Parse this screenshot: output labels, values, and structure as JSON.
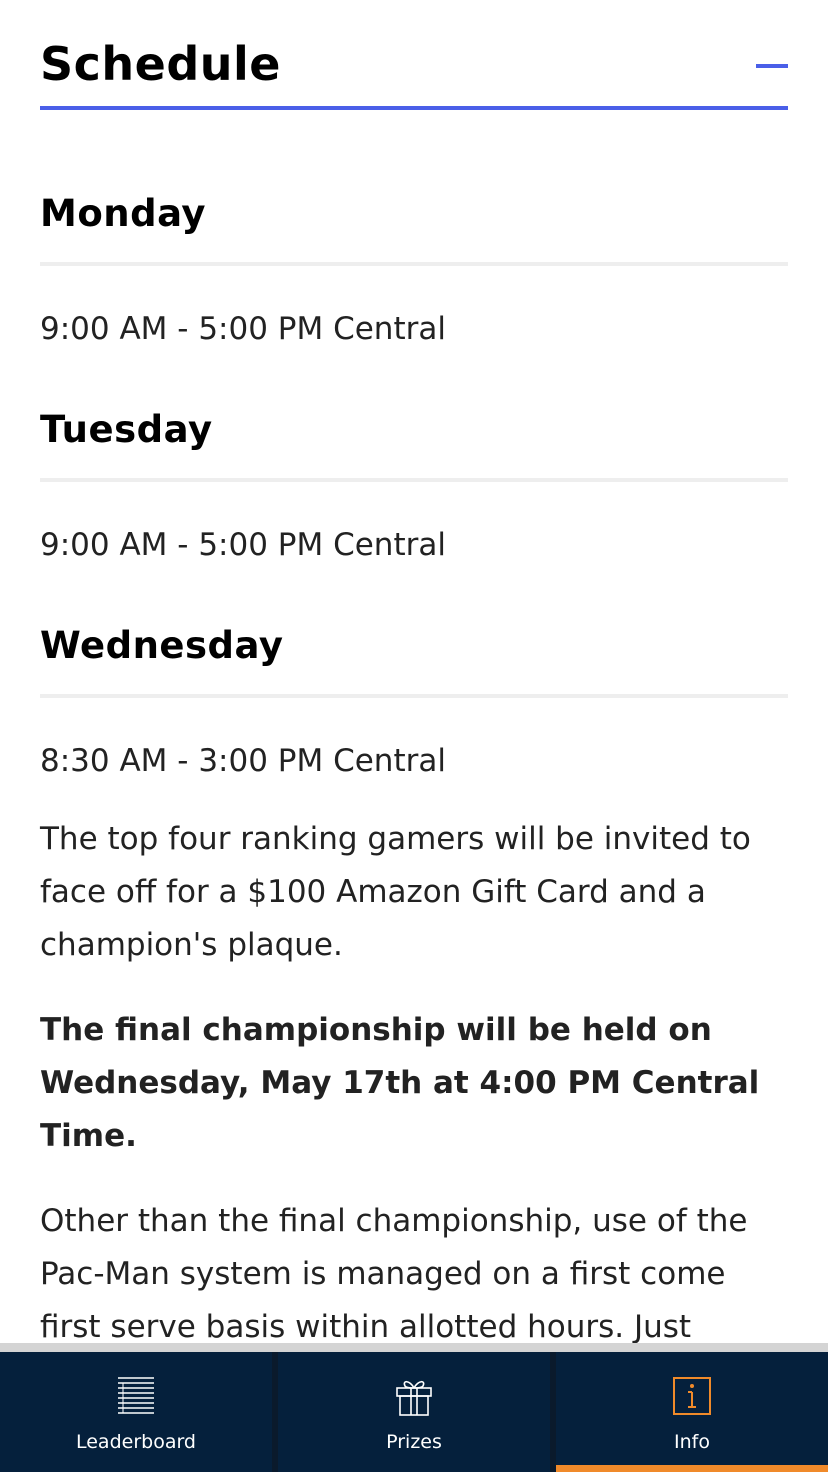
{
  "section": {
    "title": "Schedule"
  },
  "schedule": [
    {
      "day": "Monday",
      "hours": "9:00 AM - 5:00 PM Central"
    },
    {
      "day": "Tuesday",
      "hours": "9:00 AM - 5:00 PM Central"
    },
    {
      "day": "Wednesday",
      "hours": "8:30 AM - 3:00 PM Central"
    }
  ],
  "paragraphs": {
    "prize_info": "The top four ranking gamers will be invited to face off for a $100 Amazon Gift Card and a champion's plaque.",
    "final_championship": "The final championship will be held on Wednesday, May 17th at 4:00 PM Central Time.",
    "usage_policy": "Other than the final championship, use of the Pac-Man system is managed on a first come first serve basis within allotted hours. Just"
  },
  "tabs": [
    {
      "label": "Leaderboard",
      "icon": "leaderboard-icon",
      "active": false
    },
    {
      "label": "Prizes",
      "icon": "gift-icon",
      "active": false
    },
    {
      "label": "Info",
      "icon": "info-icon",
      "active": true
    }
  ],
  "colors": {
    "accent": "#4a5fe8",
    "tabbar_bg": "#05203c",
    "active_tab": "#f08a2a",
    "divider": "#eeeeee"
  }
}
